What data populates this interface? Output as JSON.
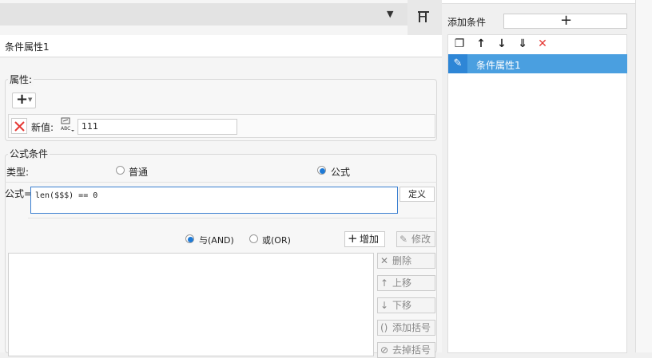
{
  "title_row": {
    "text": "条件属性1"
  },
  "properties": {
    "group_label": "属性:",
    "add_button": "+",
    "new_value_label": "新值:",
    "new_value": "111",
    "abc_icon_text": "ABC"
  },
  "formula_condition": {
    "group_label": "公式条件",
    "type_label": "类型:",
    "type_options": [
      "普通",
      "公式"
    ],
    "selected_type": "公式",
    "formula_label": "公式=",
    "formula_value": "len($$$) == 0",
    "define_button": "定义",
    "logic_options": [
      "与(AND)",
      "或(OR)"
    ],
    "selected_logic": "与(AND)",
    "add_button": "增加",
    "modify_button": "修改",
    "delete_button": "删除",
    "move_up_button": "上移",
    "move_down_button": "下移",
    "add_bracket_button": "添加括号",
    "remove_bracket_button": "去掉括号"
  },
  "right_panel": {
    "add_condition_label": "添加条件",
    "add_condition_plus": "+",
    "toolbar_icons": [
      "copy-icon",
      "arrow-up-icon",
      "arrow-down-icon",
      "move-bottom-icon",
      "delete-x-icon"
    ],
    "conditions": [
      "条件属性1"
    ]
  },
  "colors": {
    "accent": "#4a9fe0",
    "accent_dark": "#2e86d6",
    "delete_red": "#e53935"
  }
}
